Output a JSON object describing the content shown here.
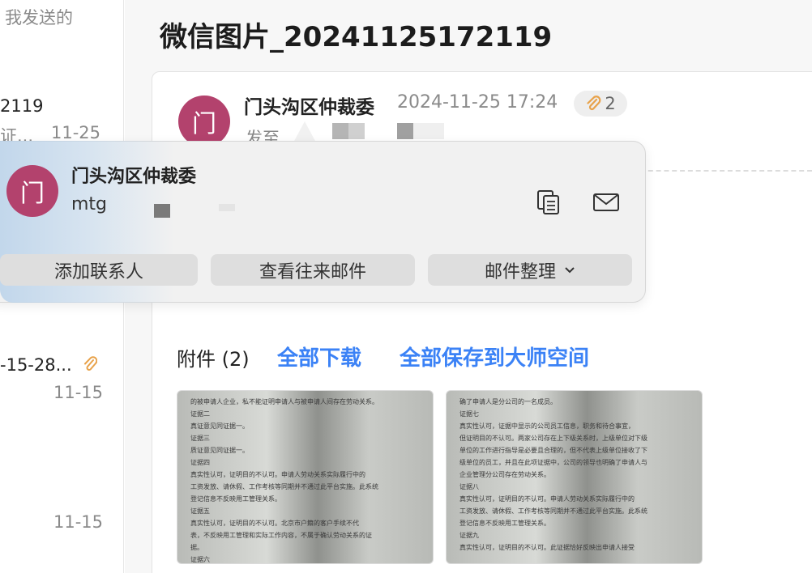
{
  "list": {
    "folder_label": "我发送的",
    "item1": {
      "title_tail": "2119",
      "preview_tail": "证...",
      "date": "11-25"
    },
    "item2": {
      "title_tail": "-15-28...",
      "date": "11-15"
    },
    "item3": {
      "date": "11-15"
    }
  },
  "mail": {
    "subject": "微信图片_20241125172119",
    "sender_name": "门头沟区仲裁委",
    "avatar_char": "门",
    "datetime": "2024-11-25 17:24",
    "attachment_count": "2",
    "to_label": "发至"
  },
  "popover": {
    "name": "门头沟区仲裁委",
    "email_prefix": "mtg",
    "avatar_char": "门",
    "add_contact": "添加联系人",
    "view_history": "查看往来邮件",
    "organize": "邮件整理"
  },
  "attachments": {
    "title": "附件 (2)",
    "download_all": "全部下载",
    "save_all": "全部保存到大师空间",
    "thumb1_lines": [
      "的被申请人企业，私不能证明申请人与被申请人间存在劳动关系。",
      "证据二",
      "真证意见同证据一。",
      "证据三",
      "质证意见同证据一。",
      "证据四",
      "真实性认可，证明目的不认可。申请人劳动关系实际履行中的",
      "工资发放、请休假、工作考核等同期并不通过此平台实施。此系统",
      "登记信息不反映用工管理关系。",
      "证据五",
      "真实性认可，证明目的不认可。北京市户籍的客户手续不代",
      "表，不反映用工管理和实际工作内容，不属于确认劳动关系的证",
      "据。",
      "证据六"
    ],
    "thumb2_lines": [
      "确了申请人是分公司的一名成员。",
      "证据七",
      "真实性认可，证据中显示的公司员工信息，职务和待合事宜，",
      "但证明目的不认可。两家公司存在上下级关系时，上级单位对下级",
      "单位的工作进行指导是必要且合理的，但不代表上级单位接收了下",
      "级单位的员工，并且在此项证据中，公司的领导也明确了申请人与",
      "企业管理分公司存在劳动关系。",
      "证据八",
      "真实性认可，证明目的不认可。申请人劳动关系实际履行中的",
      "工资发放、请休假、工作考核等同期并不通过此平台实施。此系统",
      "登记信息不反映用工管理关系。",
      "证据九",
      "真实性认可，证明目的不认可。此证据恰好反映出申请人接受"
    ]
  },
  "colors": {
    "avatar": "#b3426d",
    "link": "#3b82f6",
    "clip": "#e8a24a"
  }
}
